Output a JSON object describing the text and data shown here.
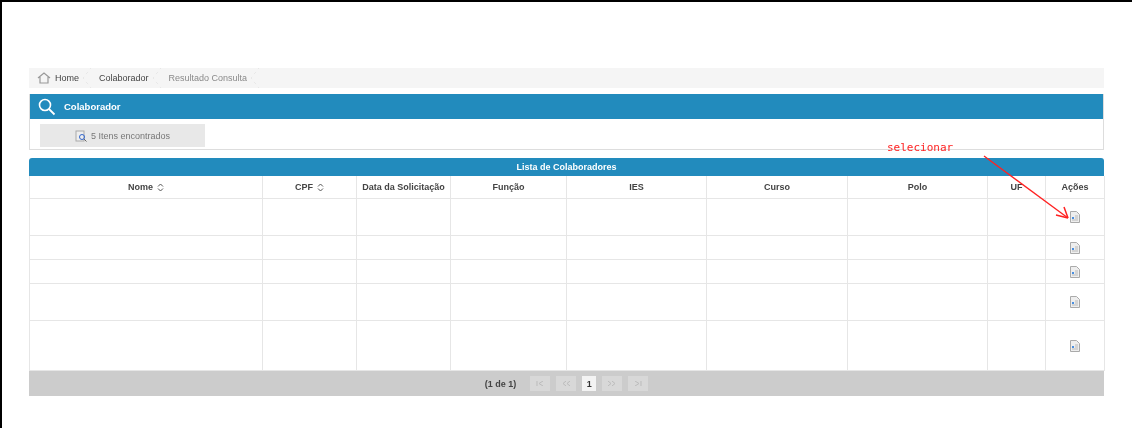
{
  "breadcrumb": [
    {
      "label": "Home",
      "kind": "home",
      "disabled": false
    },
    {
      "label": "Colaborador",
      "kind": "link",
      "disabled": false
    },
    {
      "label": "Resultado Consulta",
      "kind": "link",
      "disabled": true
    }
  ],
  "panel": {
    "title": "Colaborador",
    "results_button": "5 Itens encontrados"
  },
  "table": {
    "title": "Lista de Colaboradores",
    "columns": [
      {
        "label": "Nome",
        "sortable": true
      },
      {
        "label": "CPF",
        "sortable": true
      },
      {
        "label": "Data da Solicitação",
        "sortable": false
      },
      {
        "label": "Função",
        "sortable": false
      },
      {
        "label": "IES",
        "sortable": false
      },
      {
        "label": "Curso",
        "sortable": false
      },
      {
        "label": "Polo",
        "sortable": false
      },
      {
        "label": "UF",
        "sortable": false
      },
      {
        "label": "Ações",
        "sortable": false
      }
    ],
    "rows": [
      {
        "kind": "tall"
      },
      {
        "kind": "short"
      },
      {
        "kind": "short"
      },
      {
        "kind": "tall"
      },
      {
        "kind": "extra-tall"
      }
    ],
    "pager": {
      "summary": "(1 de 1)",
      "pages": [
        {
          "label": "1",
          "selected": true
        }
      ]
    }
  },
  "annotation": {
    "text": "selecionar"
  }
}
